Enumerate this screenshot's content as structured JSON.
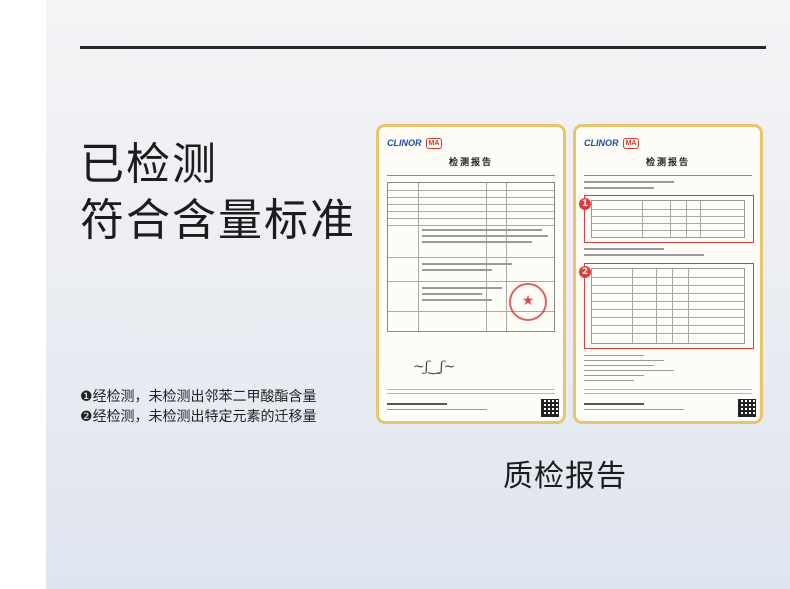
{
  "headline": {
    "line1": "已检测",
    "line2": "符合含量标准"
  },
  "notes": [
    {
      "marker": "❶",
      "text": "经检测，未检测出邻苯二甲酸酯含量"
    },
    {
      "marker": "❷",
      "text": "经检测，未检测出特定元素的迁移量"
    }
  ],
  "caption": "质检报告",
  "certificates": [
    {
      "logo_text": "CLINOR",
      "ma_text": "MA",
      "title": "检测报告"
    },
    {
      "logo_text": "CLINOR",
      "ma_text": "MA",
      "title": "检测报告",
      "markers": [
        "1",
        "2"
      ]
    }
  ],
  "colors": {
    "cert_border": "#e9c46a",
    "highlight": "#e23a3a",
    "stamp": "#d62d2d",
    "headline": "#1c1c1c"
  }
}
